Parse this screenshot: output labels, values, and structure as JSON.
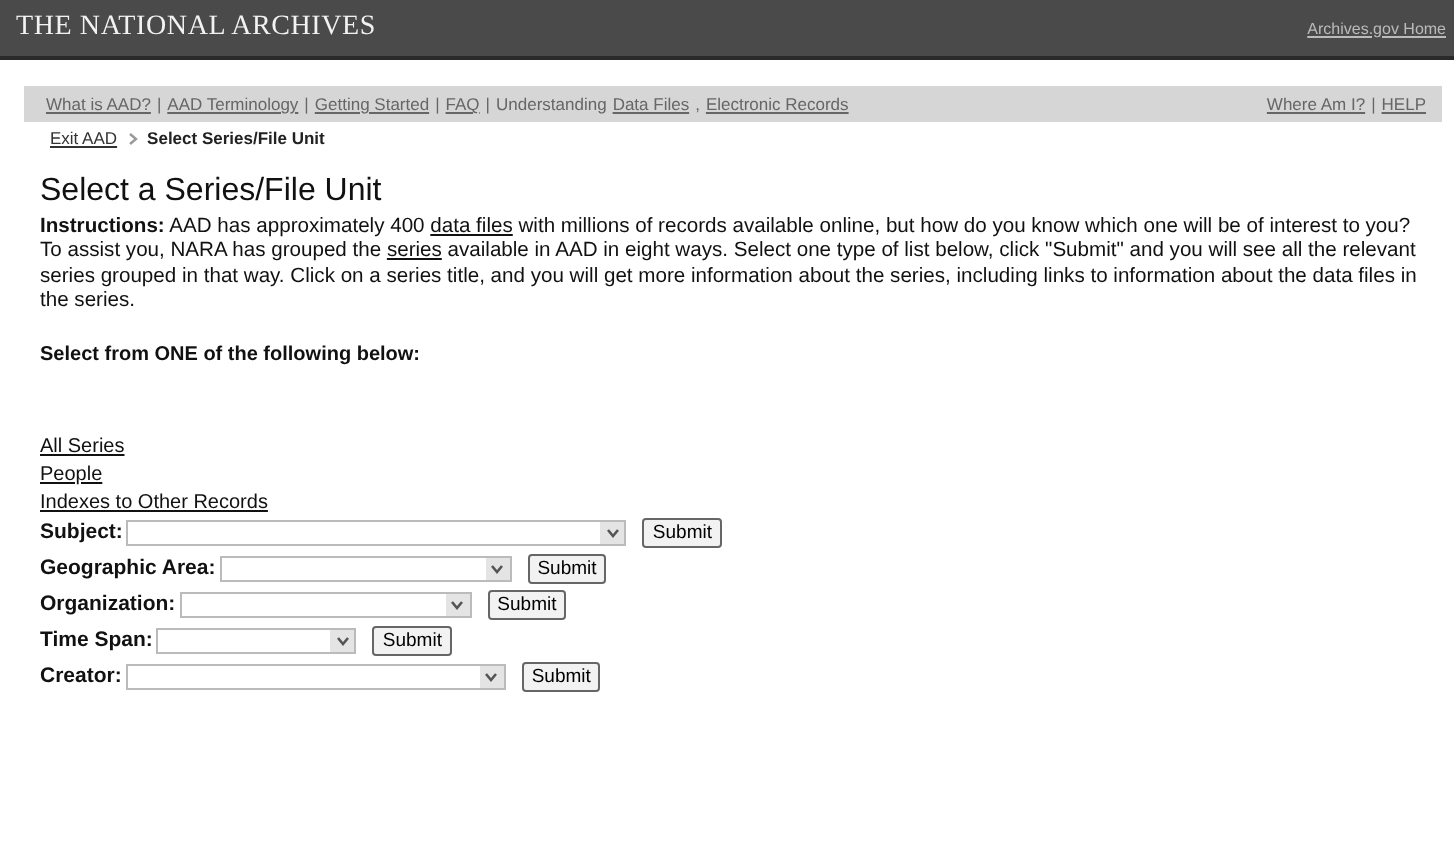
{
  "header": {
    "title": "THE NATIONAL ARCHIVES",
    "link": "Archives.gov Home"
  },
  "nav": {
    "left": [
      {
        "kind": "link",
        "label": "What is AAD?"
      },
      {
        "kind": "text",
        "label": "|"
      },
      {
        "kind": "link",
        "label": "AAD Terminology"
      },
      {
        "kind": "text",
        "label": "|"
      },
      {
        "kind": "link",
        "label": "Getting Started"
      },
      {
        "kind": "text",
        "label": "|"
      },
      {
        "kind": "link",
        "label": "FAQ"
      },
      {
        "kind": "text",
        "label": "|"
      },
      {
        "kind": "text",
        "label": "Understanding"
      },
      {
        "kind": "link",
        "label": "Data Files"
      },
      {
        "kind": "text",
        "label": ","
      },
      {
        "kind": "link",
        "label": "Electronic Records"
      }
    ],
    "right": [
      {
        "kind": "link",
        "label": "Where Am I?"
      },
      {
        "kind": "text",
        "label": "|"
      },
      {
        "kind": "link",
        "label": "HELP"
      }
    ]
  },
  "breadcrumb": [
    {
      "kind": "link",
      "label": "Exit AAD"
    },
    {
      "kind": "current",
      "label": "Select Series/File Unit"
    }
  ],
  "title": "Select a Series/File Unit",
  "instructions": [
    {
      "kind": "text",
      "text": "**Instructions:** AAD has approximately 400 "
    },
    {
      "kind": "link",
      "text": "data files"
    },
    {
      "kind": "text",
      "text": " with millions of records available online, but how do you know which one will be of interest to you? To assist you, NARA has grouped the "
    },
    {
      "kind": "link",
      "text": "series"
    },
    {
      "kind": "text",
      "text": " available in AAD in eight ways. Select one type of list below, click \"Submit\" and you will see all the relevant series grouped in that way. Click on a series title, and you will get more information about the series, including links to information about the data files in the series."
    }
  ],
  "select_heading": "Select from ONE of the following below:",
  "links": [
    "All Series",
    "People",
    "Indexes to Other Records"
  ],
  "forms": [
    {
      "label": "Subject:",
      "button": "Submit"
    },
    {
      "label": "Geographic Area:",
      "button": "Submit"
    },
    {
      "label": "Organization:",
      "button": "Submit"
    },
    {
      "label": "Time Span:",
      "button": "Submit"
    },
    {
      "label": "Creator:",
      "button": "Submit"
    }
  ]
}
